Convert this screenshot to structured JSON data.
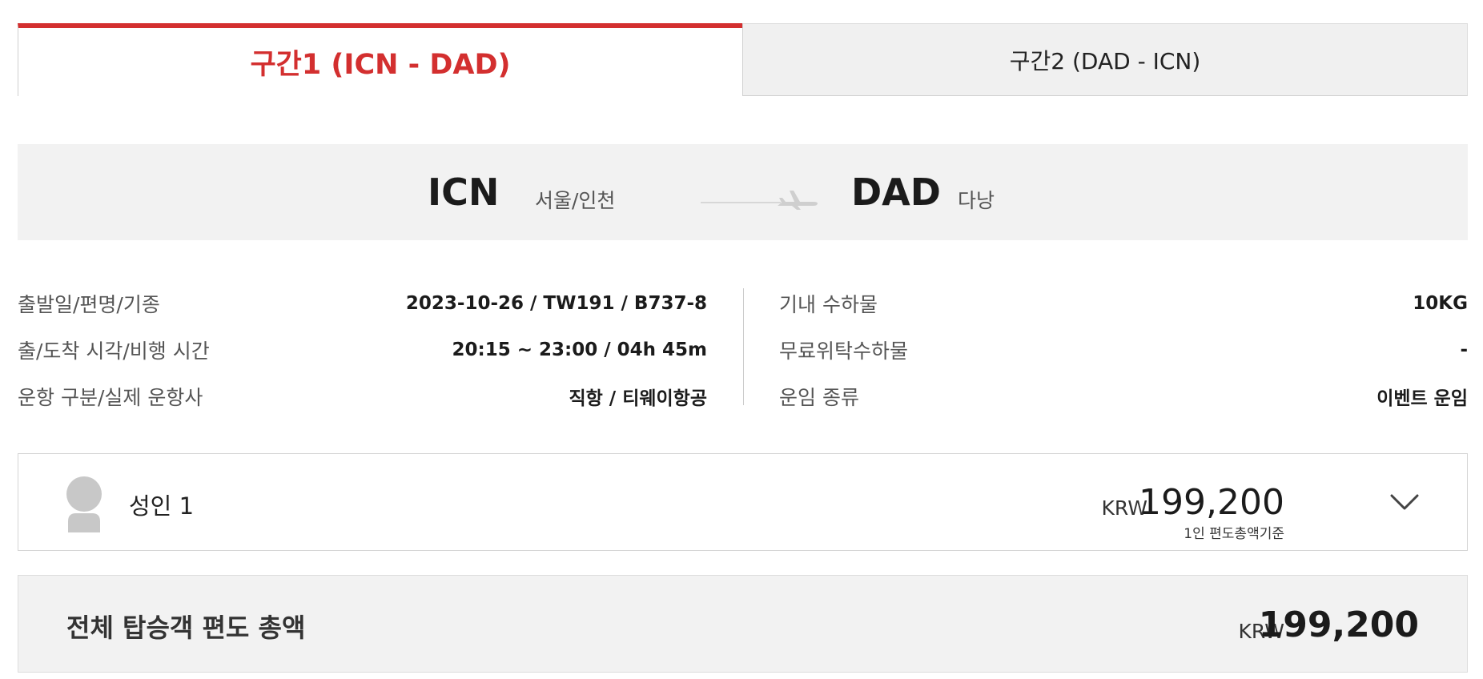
{
  "tabs": [
    {
      "label": "구간1 (ICN - DAD)",
      "active": true
    },
    {
      "label": "구간2 (DAD - ICN)",
      "active": false
    }
  ],
  "route": {
    "origin_code": "ICN",
    "origin_city": "서울/인천",
    "destination_code": "DAD",
    "destination_city": "다낭",
    "arrow_icon": "plane-icon"
  },
  "details": {
    "left": [
      {
        "label": "출발일/편명/기종",
        "value": "2023-10-26 / TW191 / B737-8"
      },
      {
        "label": "출/도착 시각/비행 시간",
        "value": "20:15 ~ 23:00 / 04h 45m"
      },
      {
        "label": "운항 구분/실제 운항사",
        "value": "직항 / 티웨이항공"
      }
    ],
    "right": [
      {
        "label": "기내 수하물",
        "value": "10KG"
      },
      {
        "label": "무료위탁수하물",
        "value": "-"
      },
      {
        "label": "운임 종류",
        "value": "이벤트 운임"
      }
    ]
  },
  "passenger": {
    "label": "성인 1",
    "currency": "KRW",
    "amount": "199,200",
    "note": "1인 편도총액기준",
    "avatar_icon": "person-avatar-icon",
    "toggle_icon": "chevron-down-icon"
  },
  "total": {
    "label": "전체 탑승객 편도 총액",
    "currency": "KRW",
    "amount": "199,200"
  },
  "colors": {
    "accent": "#d32f2f",
    "panel_bg": "#f2f2f2",
    "avatar": "#c8c8c8"
  }
}
